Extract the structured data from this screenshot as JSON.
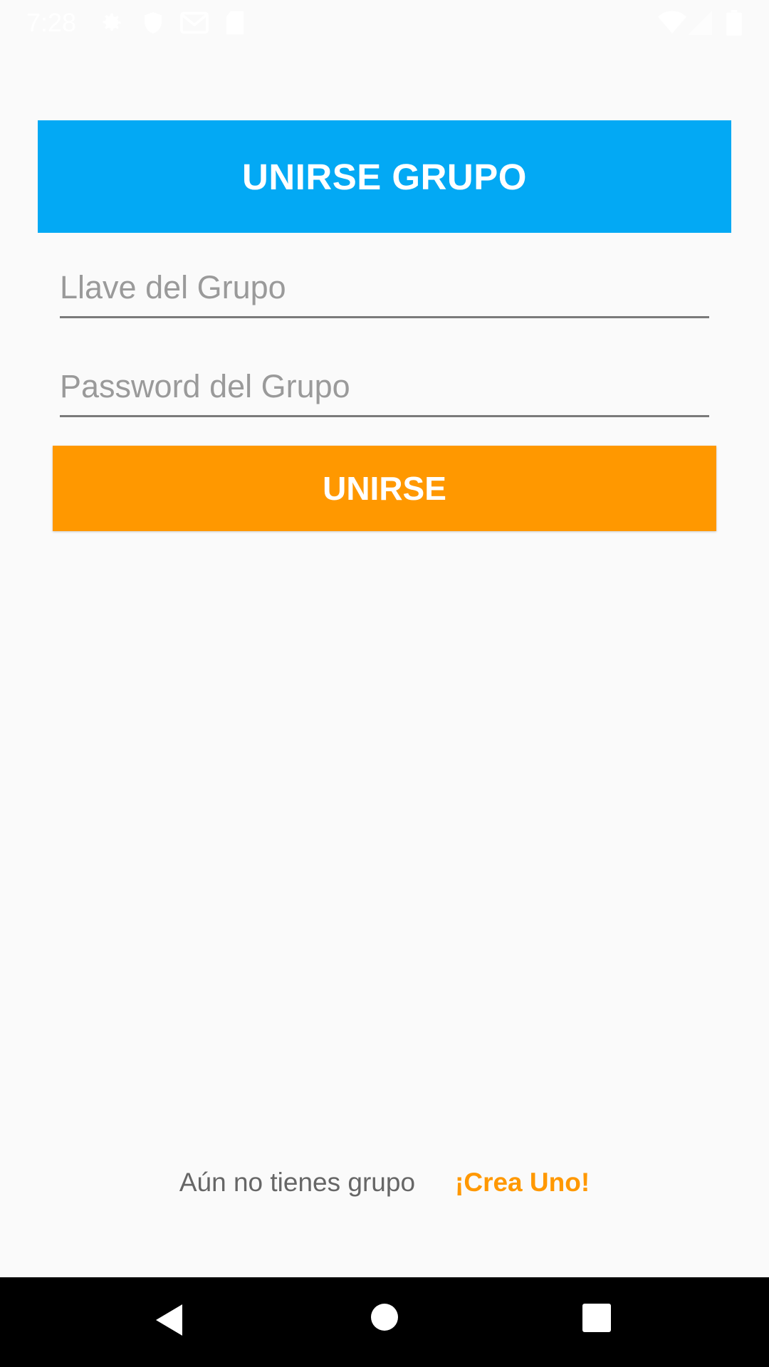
{
  "status_bar": {
    "time": "7:28",
    "icons_left": [
      "settings-icon",
      "shield-icon",
      "gmail-icon",
      "sd-card-icon"
    ],
    "icons_right": [
      "wifi-icon",
      "signal-icon",
      "battery-icon"
    ]
  },
  "header": {
    "title": "UNIRSE GRUPO",
    "color": "#03a9f4"
  },
  "form": {
    "group_key": {
      "placeholder": "Llave del Grupo",
      "value": ""
    },
    "group_password": {
      "placeholder": "Password del Grupo",
      "value": ""
    },
    "submit_label": "UNIRSE",
    "submit_color": "#ff9800"
  },
  "footer": {
    "prompt": "Aún no tienes grupo",
    "link": "¡Crea Uno!",
    "link_color": "#ff9800"
  },
  "nav_bar": {
    "buttons": [
      "back-icon",
      "home-icon",
      "recents-icon"
    ]
  }
}
